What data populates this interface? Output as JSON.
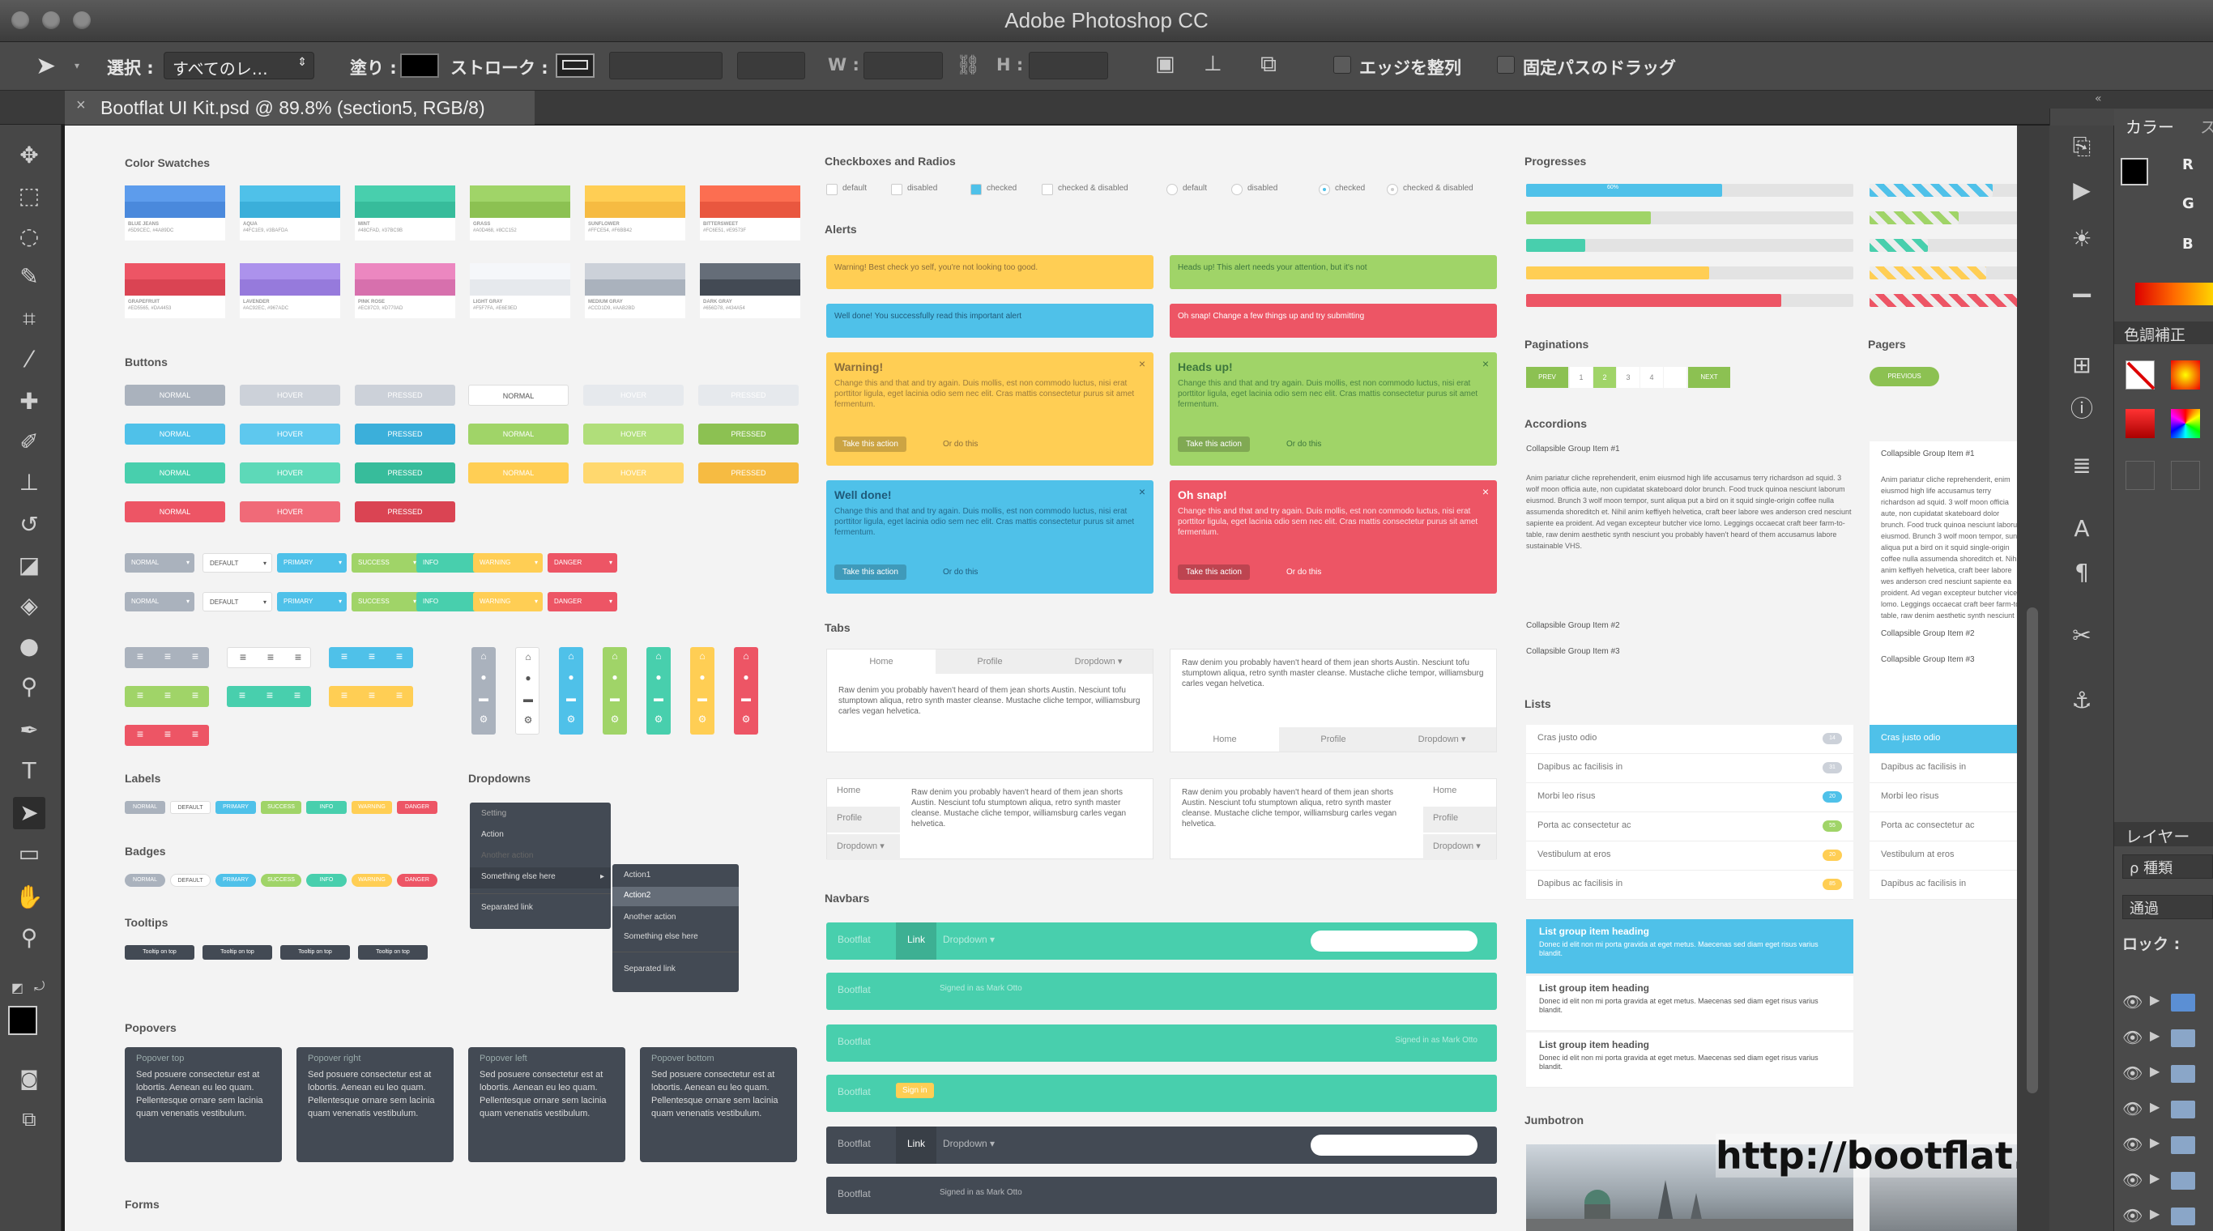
{
  "app": {
    "title": "Adobe Photoshop CC"
  },
  "options": {
    "select_label": "選択 :",
    "select_value": "すべてのレ…",
    "fill_label": "塗り :",
    "stroke_label": "ストローク :",
    "w_label": "W :",
    "h_label": "H :",
    "align_edges": "エッジを整列",
    "constrain_path": "固定パスのドラッグ"
  },
  "document": {
    "tab_label": "Bootflat UI Kit.psd @ 89.8% (section5, RGB/8)",
    "close": "×"
  },
  "panels": {
    "color_tab": "カラー",
    "color_tab2": "ス",
    "r": "R",
    "g": "G",
    "b": "B",
    "adjust": "色調補正",
    "layers": "レイヤー",
    "kind": "ρ 種類",
    "normal": "通過",
    "lock": "ロック :"
  },
  "watermark": "http://bootflat.github.io/",
  "kit": {
    "color_swatches": {
      "title": "Color Swatches",
      "items": [
        {
          "name": "BLUE JEANS",
          "codes": "#5D9CEC, #4A89DC",
          "color": "#5d9cec",
          "dark": "#4a89dc"
        },
        {
          "name": "AQUA",
          "codes": "#4FC1E9, #3BAFDA",
          "color": "#4fc1e9",
          "dark": "#3bafda"
        },
        {
          "name": "MINT",
          "codes": "#48CFAD, #37BC9B",
          "color": "#48cfad",
          "dark": "#37bc9b"
        },
        {
          "name": "GRASS",
          "codes": "#A0D468, #8CC152",
          "color": "#a0d468",
          "dark": "#8cc152"
        },
        {
          "name": "SUNFLOWER",
          "codes": "#FFCE54, #F6BB42",
          "color": "#ffce54",
          "dark": "#f6bb42"
        },
        {
          "name": "BITTERSWEET",
          "codes": "#FC6E51, #E9573F",
          "color": "#fc6e51",
          "dark": "#e9573f"
        },
        {
          "name": "GRAPEFRUIT",
          "codes": "#ED5565, #DA4453",
          "color": "#ed5565",
          "dark": "#da4453"
        },
        {
          "name": "LAVENDER",
          "codes": "#AC92EC, #967ADC",
          "color": "#ac92ec",
          "dark": "#967adc"
        },
        {
          "name": "PINK ROSE",
          "codes": "#EC87C0, #D770AD",
          "color": "#ec87c0",
          "dark": "#d770ad"
        },
        {
          "name": "LIGHT GRAY",
          "codes": "#F5F7FA, #E6E9ED",
          "color": "#f5f7fa",
          "dark": "#e6e9ed"
        },
        {
          "name": "MEDIUM GRAY",
          "codes": "#CCD1D9, #AAB2BD",
          "color": "#ccd1d9",
          "dark": "#aab2bd"
        },
        {
          "name": "DARK GRAY",
          "codes": "#656D78, #434A54",
          "color": "#656d78",
          "dark": "#434a54"
        }
      ]
    },
    "buttons": {
      "title": "Buttons",
      "normal": "NORMAL",
      "hover": "HOVER",
      "pressed": "PRESSED"
    },
    "dropdown_buttons": [
      "NORMAL",
      "DEFAULT",
      "PRIMARY",
      "SUCCESS",
      "INFO",
      "WARNING",
      "DANGER"
    ],
    "labels": {
      "title": "Labels",
      "items": [
        "NORMAL",
        "DEFAULT",
        "PRIMARY",
        "SUCCESS",
        "INFO",
        "WARNING",
        "DANGER"
      ]
    },
    "badges": {
      "title": "Badges"
    },
    "tooltips": {
      "title": "Tooltips",
      "item": "Tooltip on top"
    },
    "dropdowns": {
      "title": "Dropdowns",
      "menu": [
        "Setting",
        "Action",
        "Another action",
        "Something else here",
        "Separated link"
      ],
      "submenu": [
        "Action1",
        "Action2",
        "Another action",
        "Something else here",
        "Separated link"
      ]
    },
    "popovers": {
      "title": "Popovers",
      "items": [
        "Popover top",
        "Popover right",
        "Popover left",
        "Popover bottom"
      ],
      "body": "Sed posuere consectetur est at lobortis. Aenean eu leo quam. Pellentesque ornare sem lacinia quam venenatis vestibulum."
    },
    "forms": {
      "title": "Forms"
    },
    "checks": {
      "title": "Checkboxes and Radios",
      "items": [
        "default",
        "disabled",
        "checked",
        "checked & disabled",
        "default",
        "disabled",
        "checked",
        "checked & disabled"
      ]
    },
    "alerts": {
      "title": "Alerts",
      "warning_short": "Warning! Best check yo self, you're not looking too good.",
      "heads_short": "Heads up! This alert needs your attention, but it's not",
      "done_short": "Well done! You successfully read this important alert",
      "snap_short": "Oh snap! Change a few things up and try submitting",
      "warning_title": "Warning!",
      "heads_title": "Heads up!",
      "done_title": "Well done!",
      "snap_title": "Oh snap!",
      "body": "Change this and that and try again. Duis mollis, est non commodo luctus, nisi erat porttitor ligula, eget lacinia odio sem nec elit. Cras mattis consectetur purus sit amet fermentum.",
      "action": "Take this action",
      "or": "Or do this"
    },
    "tabs": {
      "title": "Tabs",
      "items": [
        "Home",
        "Profile",
        "Dropdown ▾"
      ],
      "body": "Raw denim you probably haven't heard of them jean shorts Austin. Nesciunt tofu stumptown aliqua, retro synth master cleanse. Mustache cliche tempor, williamsburg carles vegan helvetica."
    },
    "navbars": {
      "title": "Navbars",
      "brand": "Bootflat",
      "link": "Link",
      "dropdown": "Dropdown ▾",
      "signed": "Signed in as Mark Otto",
      "signin": "Sign in"
    },
    "progresses": {
      "title": "Progresses",
      "pct": "60%"
    },
    "paginations": {
      "title": "Paginations",
      "prev": "PREV",
      "pages": [
        "1",
        "2",
        "3",
        "4"
      ],
      "next": "NEXT"
    },
    "pagers": {
      "title": "Pagers",
      "previous": "PREVIOUS"
    },
    "accordions": {
      "title": "Accordions",
      "items": [
        "Collapsible Group Item #1",
        "Collapsible Group Item #2",
        "Collapsible Group Item #3"
      ],
      "body": "Anim pariatur cliche reprehenderit, enim eiusmod high life accusamus terry richardson ad squid. 3 wolf moon officia aute, non cupidatat skateboard dolor brunch. Food truck quinoa nesciunt laborum eiusmod. Brunch 3 wolf moon tempor, sunt aliqua put a bird on it squid single-origin coffee nulla assumenda shoreditch et. Nihil anim keffiyeh helvetica, craft beer labore wes anderson cred nesciunt sapiente ea proident. Ad vegan excepteur butcher vice lomo. Leggings occaecat craft beer farm-to-table, raw denim aesthetic synth nesciunt you probably haven't heard of them accusamus labore sustainable VHS."
    },
    "lists": {
      "title": "Lists",
      "items": [
        "Cras justo odio",
        "Dapibus ac facilisis in",
        "Morbi leo risus",
        "Porta ac consectetur ac",
        "Vestibulum at eros",
        "Dapibus ac facilisis in"
      ],
      "badges": [
        "14",
        "31",
        "20",
        "55",
        "20",
        "85"
      ],
      "heading": "List group item heading",
      "text": "Donec id elit non mi porta gravida at eget metus. Maecenas sed diam eget risus varius blandit."
    },
    "jumbotron": {
      "title": "Jumbotron"
    }
  }
}
